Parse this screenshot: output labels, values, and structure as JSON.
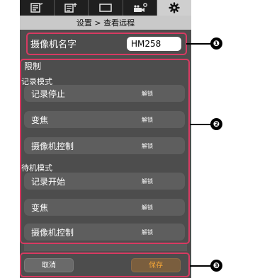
{
  "tabs": [
    {
      "icon": "record-list-icon"
    },
    {
      "icon": "upload-list-icon"
    },
    {
      "icon": "monitor-icon"
    },
    {
      "icon": "camera-settings-icon"
    },
    {
      "icon": "gear-icon"
    }
  ],
  "header": {
    "title": "设置 > 查看远程"
  },
  "camera_name": {
    "label": "摄像机名字",
    "value": "HM258"
  },
  "restrictions": {
    "title": "限制",
    "recording_mode": {
      "title": "记录模式",
      "items": [
        {
          "label": "记录停止",
          "status": "解锁"
        },
        {
          "label": "变焦",
          "status": "解锁"
        },
        {
          "label": "摄像机控制",
          "status": "解锁"
        }
      ]
    },
    "standby_mode": {
      "title": "待机模式",
      "items": [
        {
          "label": "记录开始",
          "status": "解锁"
        },
        {
          "label": "变焦",
          "status": "解锁"
        },
        {
          "label": "摄像机控制",
          "status": "解锁"
        }
      ]
    }
  },
  "buttons": {
    "cancel": "取消",
    "save": "保存"
  },
  "callouts": [
    "❶",
    "❷",
    "❸"
  ],
  "colors": {
    "highlight": "#d83a62",
    "save_text": "#f2a437",
    "panel": "#4d4d4d"
  }
}
